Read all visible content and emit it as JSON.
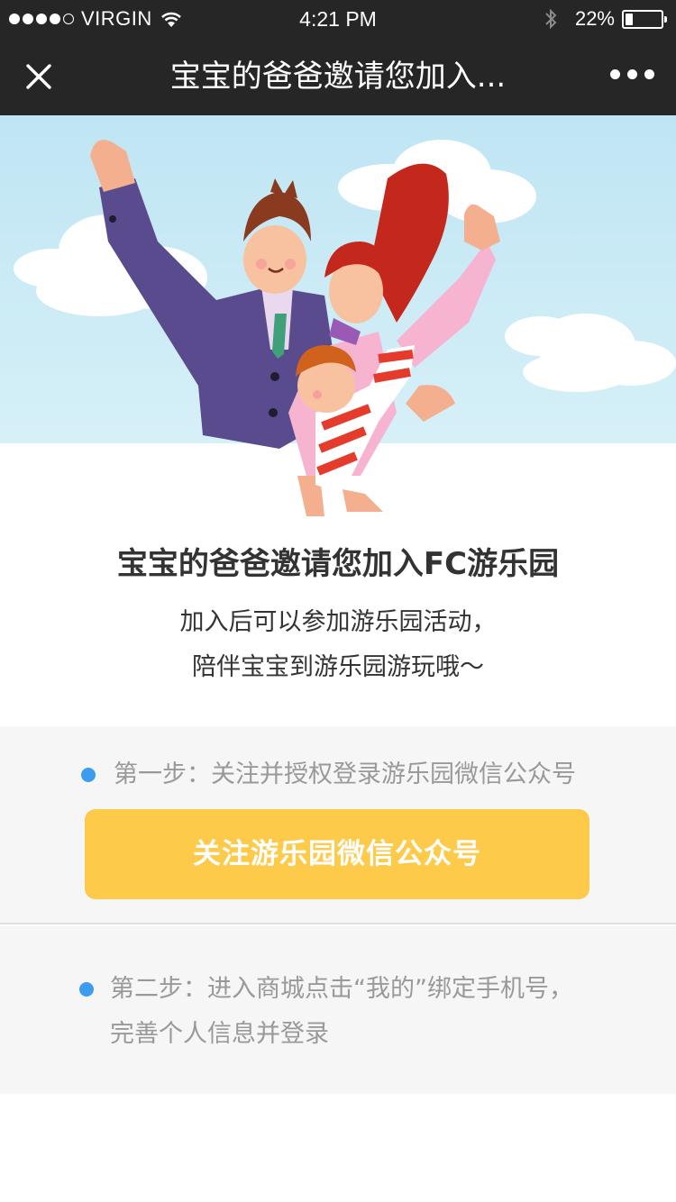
{
  "status_bar": {
    "carrier": "VIRGIN",
    "time": "4:21 PM",
    "battery": "22%",
    "battery_level": 0.22,
    "signal_bars": 4,
    "signal_max": 5
  },
  "nav": {
    "title": "宝宝的爸爸邀请您加入...",
    "close_icon": "close-icon",
    "more_icon": "more-dots-icon"
  },
  "hero": {
    "image": "family-illustration"
  },
  "content": {
    "title": "宝宝的爸爸邀请您加入FC游乐园",
    "desc_line1": "加入后可以参加游乐园活动，",
    "desc_line2": "陪伴宝宝到游乐园游玩哦～"
  },
  "steps": {
    "step1_text": "第一步：关注并授权登录游乐园微信公众号",
    "step1_button": "关注游乐园微信公众号",
    "step2_line1": "第二步：进入商城点击“我的”绑定手机号，",
    "step2_line2": "完善个人信息并登录"
  },
  "colors": {
    "accent_button": "#fdca4a",
    "bullet": "#3d9cf0",
    "nav_bg": "#262626"
  }
}
